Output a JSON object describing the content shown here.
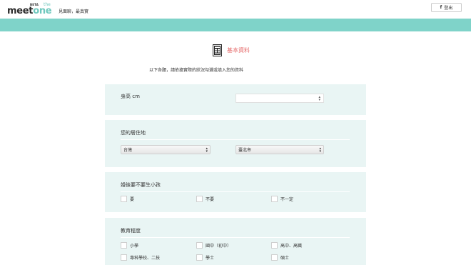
{
  "header": {
    "logo": {
      "beta": "BETA",
      "the": "the",
      "meet": "meet",
      "one": "one"
    },
    "tagline": "見面聊，最真實",
    "logout_icon": "f",
    "logout_label": "登出"
  },
  "colors": {
    "accent": "#7fd3c9",
    "title_red": "#e56a6a",
    "card_bg": "#e9f5f4"
  },
  "section": {
    "icon": "document-icon",
    "title": "基本資料"
  },
  "intro": "以下各題，請依據實際的狀況勾選或填入您的資料",
  "height": {
    "label": "身高 cm",
    "value": ""
  },
  "residence": {
    "label": "您的居住地",
    "country": "台灣",
    "city": "臺北市"
  },
  "children": {
    "label": "婚後要不要生小孩",
    "options": [
      "要",
      "不要",
      "不一定"
    ]
  },
  "education": {
    "label": "教育程度",
    "options": [
      "小學",
      "國中（初中）",
      "高中、高職",
      "專科學校、二技",
      "學士",
      "碩士"
    ]
  }
}
